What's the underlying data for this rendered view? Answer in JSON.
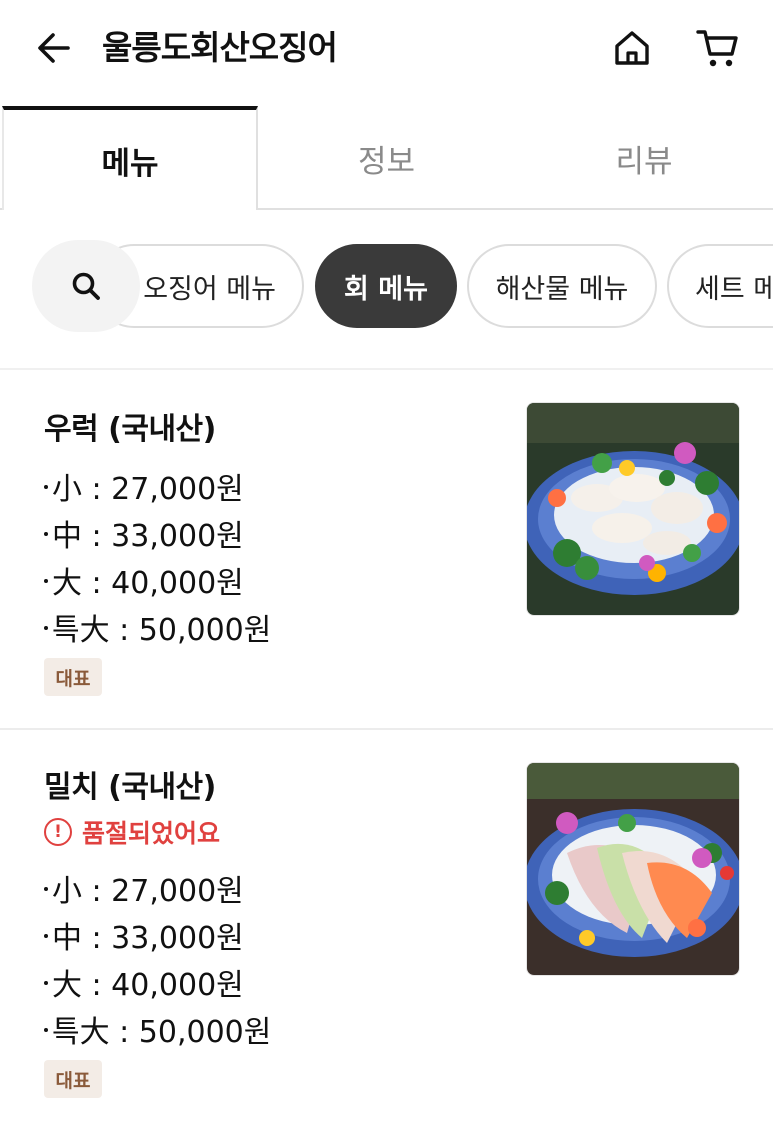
{
  "header": {
    "title": "울릉도회산오징어",
    "back_icon": "arrow-left-icon",
    "home_icon": "home-icon",
    "cart_icon": "cart-icon"
  },
  "tabs": [
    {
      "label": "메뉴",
      "active": true
    },
    {
      "label": "정보",
      "active": false
    },
    {
      "label": "리뷰",
      "active": false
    }
  ],
  "categories": {
    "search_icon": "search-icon",
    "items": [
      {
        "label": "오징어 메뉴",
        "active": false
      },
      {
        "label": "회 메뉴",
        "active": true
      },
      {
        "label": "해산물 메뉴",
        "active": false
      },
      {
        "label": "세트 메뉴",
        "active": false
      }
    ]
  },
  "menu_items": [
    {
      "name": "우럭 (국내산)",
      "sold_out": false,
      "prices": [
        "小 : 27,000원",
        "中 : 33,000원",
        "大 : 40,000원",
        "특大 : 50,000원"
      ],
      "badge": "대표",
      "image": "sashimi-platter-image"
    },
    {
      "name": "밀치 (국내산)",
      "sold_out": true,
      "sold_out_label": "품절되었어요",
      "prices": [
        "小 : 27,000원",
        "中 : 33,000원",
        "大 : 40,000원",
        "특大 : 50,000원"
      ],
      "badge": "대표",
      "image": "sashimi-platter-image"
    }
  ],
  "colors": {
    "accent_dark": "#3a3a3a",
    "sold_out_red": "#e0413f",
    "badge_bg": "#f3ece6",
    "badge_text": "#8a5a3a"
  }
}
